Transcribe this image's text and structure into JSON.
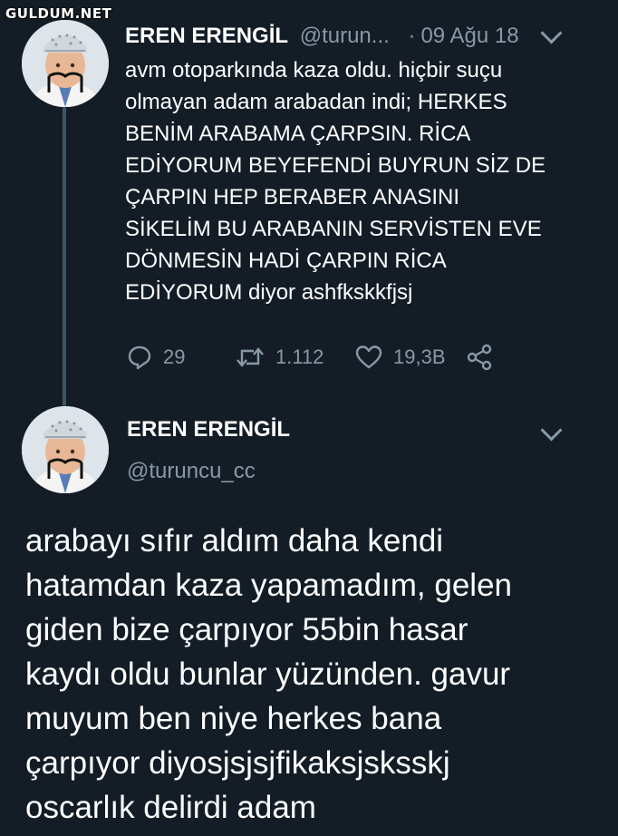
{
  "watermark": "GULDUM.NET",
  "reply_tweet": {
    "author_name": "EREN ERENGİL",
    "handle": "@turun...",
    "separator": "·",
    "date": "09 Ağu 18",
    "text": "avm otoparkında kaza oldu. hiçbir suçu\nolmayan adam arabadan indi; HERKES\nBENİM ARABAMA ÇARPSIN. RİCA\nEDİYORUM BEYEFENDİ BUYRUN SİZ DE\nÇARPIN HEP BERABER ANASINI\nSİKELİM BU ARABANIN SERVİSTEN EVE\nDÖNMESİN HADİ ÇARPIN RİCA\nEDİYORUM diyor ashfkskkfjsj",
    "actions": {
      "replies": "29",
      "retweets": "1.112",
      "likes": "19,3B",
      "icons": [
        "reply-icon",
        "retweet-icon",
        "like-icon",
        "share-icon"
      ]
    }
  },
  "main_tweet": {
    "author_name": "EREN ERENGİL",
    "handle": "@turuncu_cc",
    "text": "arabayı sıfır aldım daha kendi\nhatamdan kaza yapamadım, gelen\ngiden bize çarpıyor 55bin hasar\nkaydı oldu bunlar yüzünden. gavur\nmuyum ben niye herkes bana\nçarpıyor diyosjsjsjfikaksjsksskj\noscarlık delirdi adam"
  },
  "colors": {
    "background": "#141d26",
    "text": "#ffffff",
    "secondary": "#8899a6",
    "thread_line": "#3d5466"
  }
}
